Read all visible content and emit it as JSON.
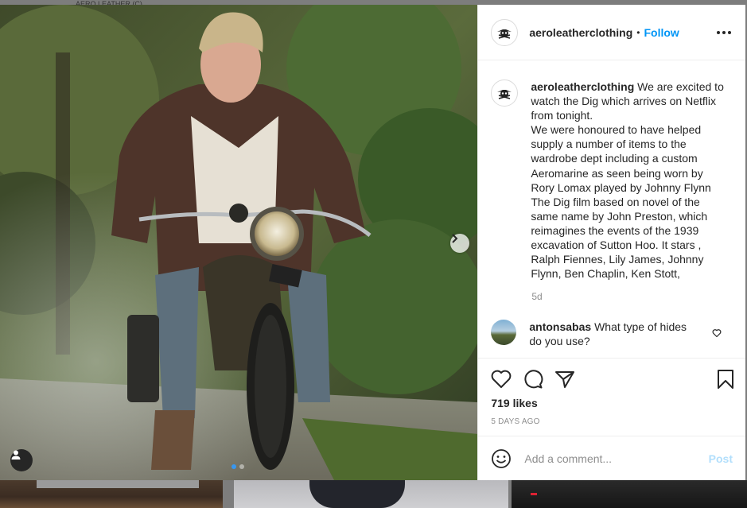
{
  "post": {
    "username": "aeroleatherclothing",
    "separator": "•",
    "follow_label": "Follow",
    "caption_lines": [
      "We are excited to",
      "watch the Dig which arrives on Netflix",
      "from tonight.",
      "We were honoured to have helped",
      "supply a number of items to the",
      "wardrobe dept including a custom",
      "Aeromarine as seen being worn by",
      "Rory Lomax played by Johnny Flynn",
      "The Dig film based on novel of the",
      "same name by John Preston, which",
      "reimagines the events of the 1939",
      "excavation of Sutton Hoo. It stars ,",
      "Ralph Fiennes, Lily James, Johnny",
      "Flynn, Ben Chaplin, Ken Stott,"
    ],
    "caption_time": "5d",
    "comment": {
      "username": "antonsabas",
      "text_line1": "What type of hides",
      "text_line2": "do you use?"
    },
    "likes": "719 likes",
    "date": "5 DAYS AGO",
    "add_comment_placeholder": "Add a comment...",
    "post_button": "Post",
    "carousel": {
      "slides": 2,
      "active_index": 0
    },
    "background_text": "AERO LEATHER (C)"
  },
  "colors": {
    "link_blue": "#0095f6",
    "post_disabled": "#b2dffc",
    "muted": "#8e8e8e",
    "text": "#262626"
  },
  "icons": [
    "chevron-right-icon",
    "user-tag-icon",
    "more-icon",
    "heart-icon",
    "comment-icon",
    "share-icon",
    "bookmark-icon",
    "emoji-icon",
    "skull-logo-icon"
  ]
}
